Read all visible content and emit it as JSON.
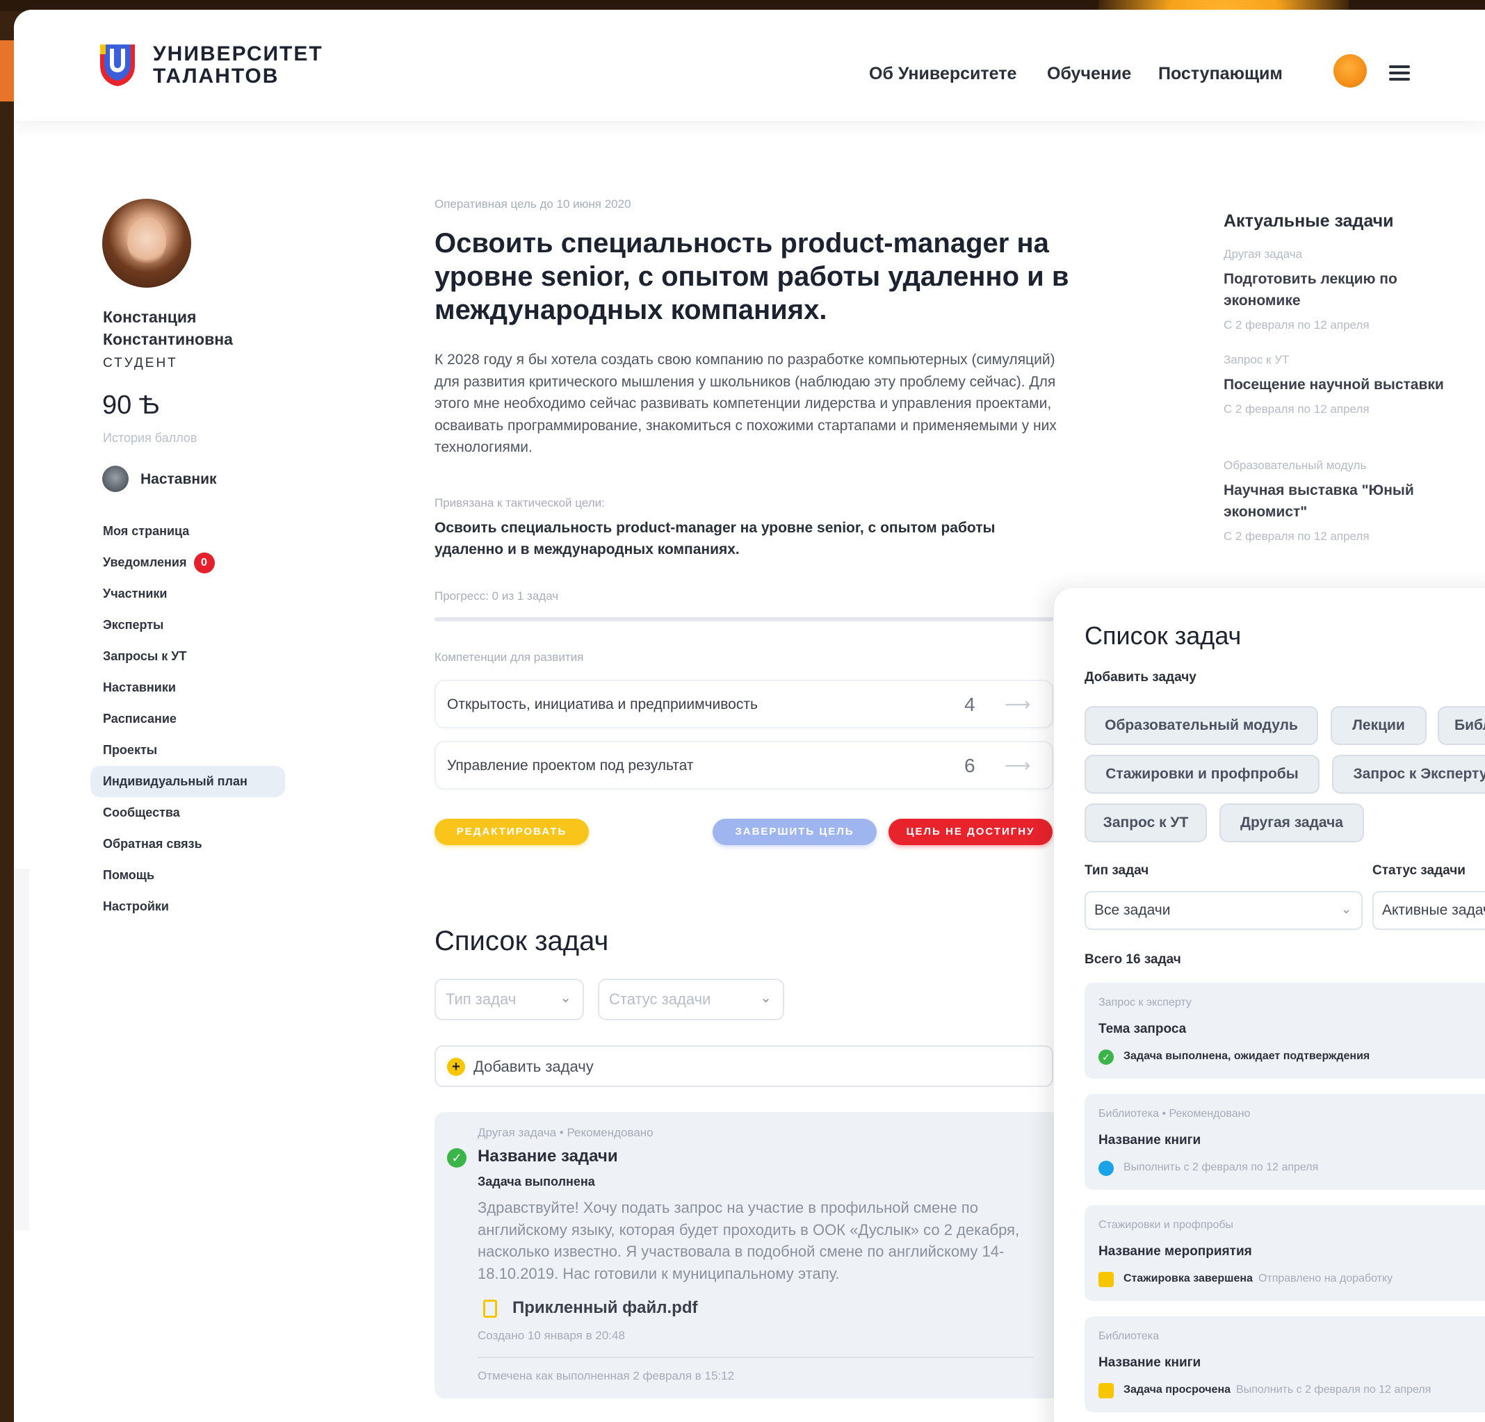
{
  "header": {
    "logo_line1": "УНИВЕРСИТЕТ",
    "logo_line2": "ТАЛАНТОВ",
    "nav": [
      "Об Университете",
      "Обучение",
      "Поступающим"
    ]
  },
  "profile": {
    "name_line1": "Констанция",
    "name_line2": "Константиновна",
    "role": "СТУДЕНТ",
    "points": "90 Ѣ",
    "points_history": "История баллов",
    "mentor": "Наставник"
  },
  "menu": {
    "items": [
      {
        "label": "Моя страница"
      },
      {
        "label": "Уведомления",
        "badge": "0"
      },
      {
        "label": "Участники"
      },
      {
        "label": "Эксперты"
      },
      {
        "label": "Запросы к УТ"
      },
      {
        "label": "Наставники"
      },
      {
        "label": "Расписание"
      },
      {
        "label": "Проекты"
      },
      {
        "label": "Индивидуальный план",
        "active": true
      },
      {
        "label": "Сообщества"
      },
      {
        "label": "Обратная связь"
      },
      {
        "label": "Помощь"
      },
      {
        "label": "Настройки"
      }
    ]
  },
  "goal": {
    "meta": "Оперативная цель до 10 июня 2020",
    "title": "Освоить специальность product-manager на уровне senior, с опытом работы удаленно и в международных компаниях.",
    "description": "К 2028 году я бы хотела создать свою компанию по разработке компьютерных (симуляций) для развития критического мышления у школьников (наблюдаю эту проблему сейчас). Для этого мне необходимо сейчас развивать компетенции лидерства и управления проектами, осваивать программирование, знакомиться с похожими стартапами и применяемыми у них технологиями.",
    "linked_label": "Привязана к тактической цели:",
    "linked_text": "Освоить специальность product-manager на уровне senior, с опытом работы удаленно и в международных компаниях.",
    "progress_label": "Прогресс: 0 из 1 задач",
    "progress_fraction": 0,
    "competencies_label": "Компетенции для развития",
    "competencies": [
      {
        "name": "Открытость, инициатива и предприимчивость",
        "value": "4"
      },
      {
        "name": "Управление проектом под результат",
        "value": "6"
      }
    ],
    "btn_edit": "РЕДАКТИРОВАТЬ",
    "btn_finish": "ЗАВЕРШИТЬ ЦЕЛЬ",
    "btn_fail": "ЦЕЛЬ НЕ ДОСТИГНУ"
  },
  "tasks": {
    "title": "Список задач",
    "type_placeholder": "Тип задач",
    "status_placeholder": "Статус задачи",
    "add_task": "Добавить задачу",
    "card": {
      "meta": "Другая задача • Рекомендовано",
      "title": "Название задачи",
      "status": "Задача выполнена",
      "body": "Здравствуйте! Хочу подать запрос на участие в профильной смене по английскому языку, которая будет проходить в ООК «Дуслык» со 2 декабря, насколько известно. Я участвовала в подобной смене по английскому 14-18.10.2019. Нас готовили к муниципальному этапу.",
      "file": "Прикленный файл.pdf",
      "created": "Создано 10 января в 20:48",
      "done": "Отмечена как выполненная 2 февраля в 15:12"
    }
  },
  "actual": {
    "title": "Актуальные задачи",
    "items": [
      {
        "category": "Другая задача",
        "title": "Подготовить лекцию по экономике",
        "dates": "С 2 февраля по 12 апреля"
      },
      {
        "category": "Запрос к УТ",
        "title": "Посещение научной выставки",
        "dates": "С 2 февраля по 12 апреля"
      },
      {
        "category": "Образовательный модуль",
        "title": "Научная выставка \"Юный экономист\"",
        "dates": "С 2 февраля по 12 апреля"
      }
    ]
  },
  "panel": {
    "title": "Список задач",
    "add_label": "Добавить задачу",
    "chips": [
      "Образовательный модуль",
      "Лекции",
      "Библи",
      "Стажировки и профпробы",
      "Запрос к Эксперту",
      "Запрос к УТ",
      "Другая задача"
    ],
    "type_label": "Тип задач",
    "status_label": "Статус задачи",
    "type_value": "Все задачи",
    "status_value": "Активные задач",
    "total": "Всего 16 задач",
    "cards": [
      {
        "category": "Запрос к эксперту",
        "title": "Тема запроса",
        "status_bold": "Задача выполнена, ожидает подтверждения",
        "status_grey": "",
        "icon": "check"
      },
      {
        "category": "Библиотека • Рекомендовано",
        "title": "Название книги",
        "status_bold": "",
        "status_grey": "Выполнить с 2 февраля по 12 апреля",
        "icon": "clock"
      },
      {
        "category": "Стажировки и профпробы",
        "title": "Название мероприятия",
        "status_bold": "Стажировка завершена",
        "status_grey": "Отправлено на доработку",
        "icon": "flag"
      },
      {
        "category": "Библиотека",
        "title": "Название книги",
        "status_bold": "Задача просрочена",
        "status_grey": "Выполнить с 2 февраля по 12 апреля",
        "icon": "flag"
      }
    ]
  }
}
